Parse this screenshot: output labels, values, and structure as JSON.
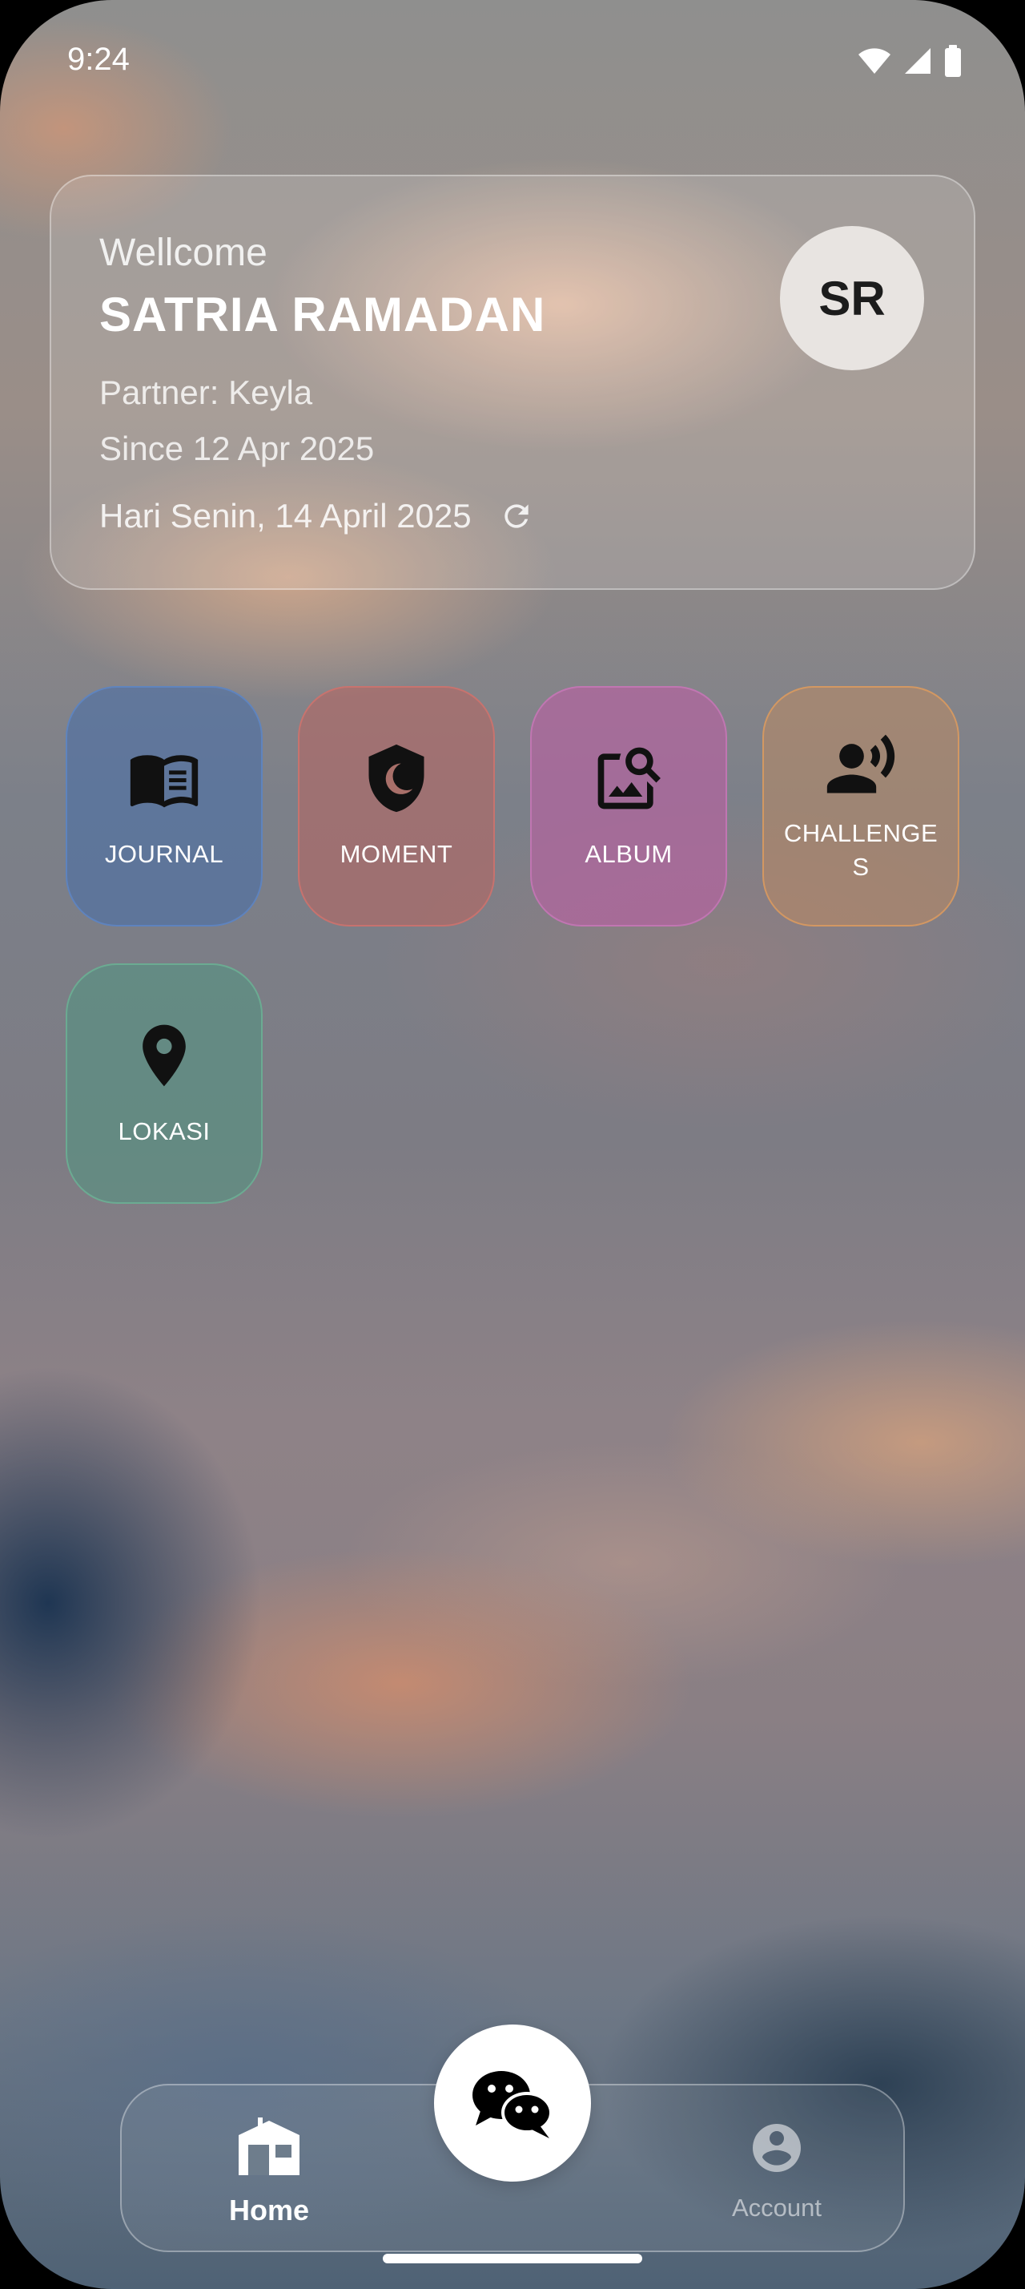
{
  "status_bar": {
    "time": "9:24"
  },
  "profile_card": {
    "greeting": "Wellcome",
    "name": "SATRIA RAMADAN",
    "partner": "Partner: Keyla",
    "since": "Since 12 Apr 2025",
    "date": "Hari Senin, 14 April 2025",
    "avatar_initials": "SR"
  },
  "menu": {
    "items": [
      {
        "label": "JOURNAL",
        "icon": "book-icon",
        "color": "#466EAA"
      },
      {
        "label": "MOMENT",
        "icon": "shield-moon-icon",
        "color": "#B9645F"
      },
      {
        "label": "ALBUM",
        "icon": "image-search-icon",
        "color": "#B464A0"
      },
      {
        "label": "CHALLENGE\nS",
        "icon": "person-voice-icon",
        "color": "#C88C5A"
      },
      {
        "label": "LOKASI",
        "icon": "location-pin-icon",
        "color": "#509682"
      }
    ]
  },
  "bottom_nav": {
    "home_label": "Home",
    "account_label": "Account",
    "chat_icon": "chat-bubbles-icon"
  }
}
